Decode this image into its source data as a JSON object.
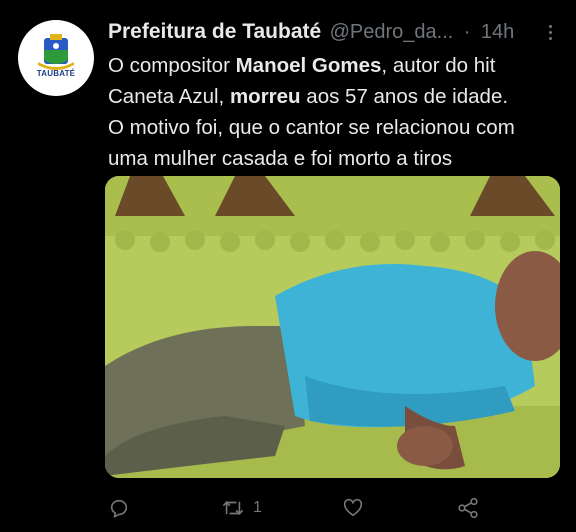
{
  "account": {
    "avatar_text": "TAUBATÉ",
    "name": "Prefeitura de Taubaté",
    "handle": "@Pedro_da...",
    "separator": "·",
    "time": "14h"
  },
  "tweet": {
    "t1": "O compositor ",
    "b1": "Manoel Gomes",
    "t2": ", autor do hit",
    "t3": "Caneta Azul, ",
    "b2": "morreu",
    "t4": " aos 57 anos de idade.",
    "t5": "O motivo foi, que o cantor se relacionou com",
    "t6": "uma mulher casada e foi morto a tiros"
  },
  "media": {
    "icon": "photo-image",
    "colors": {
      "grass": "#b5c95a",
      "trees": "#6b4a2a",
      "shirt": "#3fb3d6"
    }
  },
  "actions": {
    "reply_icon": "comment-icon",
    "retweet_icon": "retweet-icon",
    "retweet_count": "1",
    "like_icon": "heart-icon",
    "share_icon": "share-icon"
  },
  "colors": {
    "background": "#000000",
    "text": "#e7e9ea",
    "muted": "#71767b"
  }
}
